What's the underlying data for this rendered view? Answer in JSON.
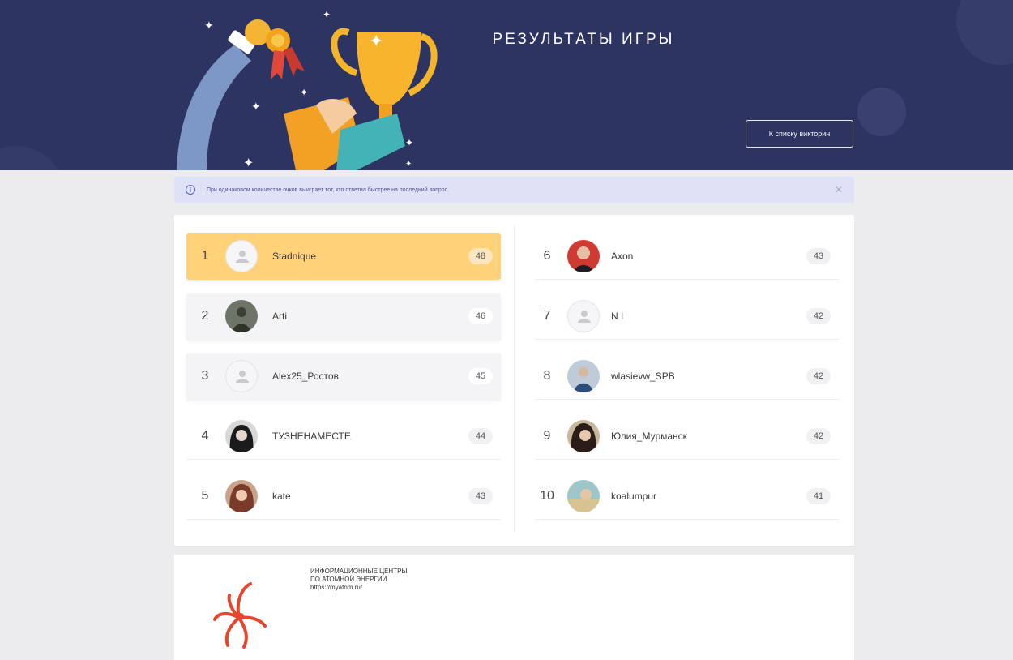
{
  "header": {
    "title": "РЕЗУЛЬТАТЫ ИГРЫ",
    "back_button": "К списку викторин"
  },
  "notice": {
    "text": "При одинаковом количестве очков выиграет тот, кто ответил быстрее на последний вопрос.",
    "icon": "info-icon",
    "close_icon": "close-icon"
  },
  "leaderboard": [
    {
      "rank": "1",
      "name": "Stadnique",
      "score": "48"
    },
    {
      "rank": "2",
      "name": "Arti",
      "score": "46"
    },
    {
      "rank": "3",
      "name": "Alex25_Ростов",
      "score": "45"
    },
    {
      "rank": "4",
      "name": "ТУЗНЕНАМЕСТЕ",
      "score": "44"
    },
    {
      "rank": "5",
      "name": "kate",
      "score": "43"
    },
    {
      "rank": "6",
      "name": "Axon",
      "score": "43"
    },
    {
      "rank": "7",
      "name": "N I",
      "score": "42"
    },
    {
      "rank": "8",
      "name": "wlasievw_SPB",
      "score": "42"
    },
    {
      "rank": "9",
      "name": "Юлия_Мурманск",
      "score": "42"
    },
    {
      "rank": "10",
      "name": "koalumpur",
      "score": "41"
    }
  ],
  "footer": {
    "org_line1": "ИНФОРМАЦИОННЫЕ ЦЕНТРЫ",
    "org_line2": "ПО АТОМНОЙ ЭНЕРГИИ",
    "url": "https://myatom.ru/"
  },
  "colors": {
    "header_bg": "#2e3461",
    "first_place": "#ffd27a",
    "notice_bg": "#dfe1f7"
  }
}
